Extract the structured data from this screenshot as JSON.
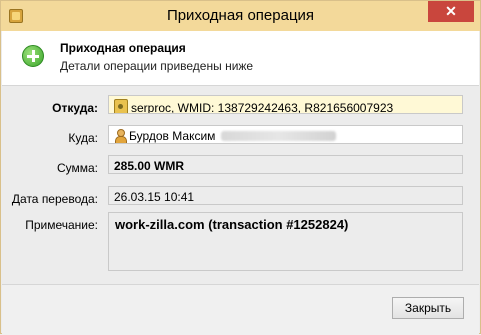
{
  "window": {
    "title": "Приходная операция",
    "close_glyph": "✕"
  },
  "header": {
    "title": "Приходная операция",
    "subtitle": "Детали операции приведены ниже",
    "icon": "plus-icon"
  },
  "fields": {
    "from_label": "Откуда:",
    "from_value": "serproc, WMID: 138729242463, R821656007923",
    "to_label": "Куда:",
    "to_value": "Бурдов Максим",
    "amount_label": "Сумма:",
    "amount_value": "285.00 WMR",
    "date_label": "Дата перевода:",
    "date_value": "26.03.15 10:41",
    "note_label": "Примечание:",
    "note_value": "work-zilla.com (transaction #1252824)"
  },
  "footer": {
    "close_button": "Закрыть"
  }
}
